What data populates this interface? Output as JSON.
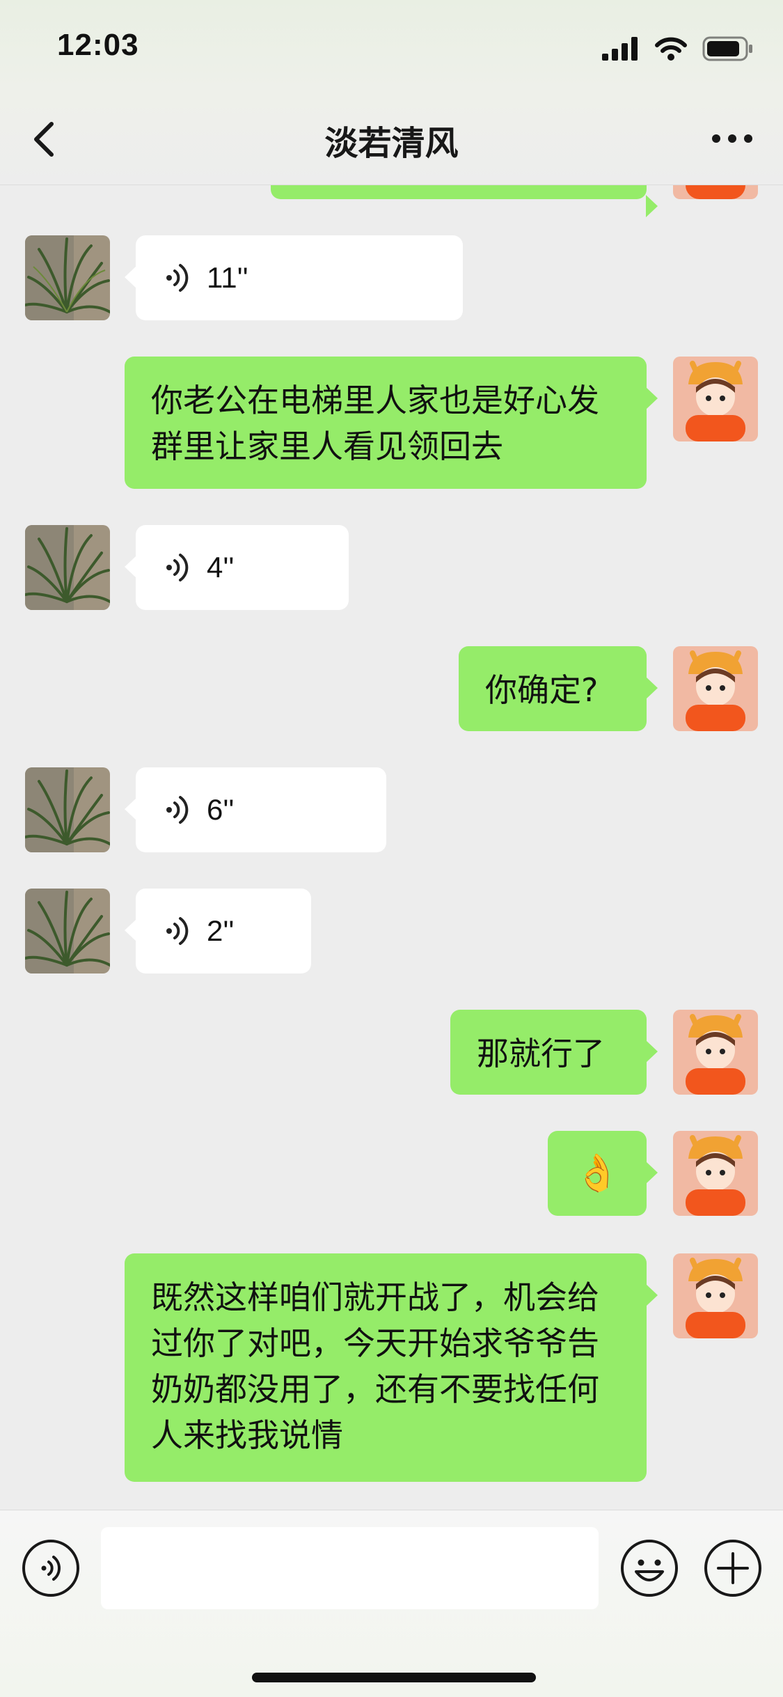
{
  "status_bar": {
    "time": "12:03"
  },
  "header": {
    "title": "淡若清风"
  },
  "messages": [
    {
      "side": "right",
      "type": "partial"
    },
    {
      "side": "left",
      "type": "voice",
      "duration": "11''"
    },
    {
      "side": "right",
      "type": "text",
      "text": "你老公在电梯里人家也是好心发群里让家里人看见领回去"
    },
    {
      "side": "left",
      "type": "voice",
      "duration": "4''"
    },
    {
      "side": "right",
      "type": "text",
      "text": "你确定?"
    },
    {
      "side": "left",
      "type": "voice",
      "duration": "6''"
    },
    {
      "side": "left",
      "type": "voice",
      "duration": "2''"
    },
    {
      "side": "right",
      "type": "text",
      "text": "那就行了"
    },
    {
      "side": "right",
      "type": "emoji",
      "text": "👌"
    },
    {
      "side": "right",
      "type": "text",
      "text": "既然这样咱们就开战了，机会给过你了对吧，今天开始求爷爷告奶奶都没用了，还有不要找任何人来找我说情"
    }
  ],
  "input_bar": {
    "value": ""
  },
  "colors": {
    "outgoing_bubble": "#95ec69",
    "incoming_bubble": "#ffffff",
    "background": "#ededed"
  }
}
